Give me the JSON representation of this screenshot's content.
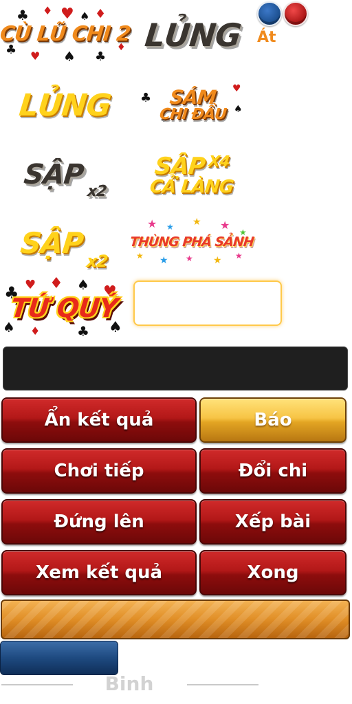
{
  "badges": {
    "cu_lu": "CÙ LŨ CHI 2",
    "lung_dark": "LỦNG",
    "lung_yellow": "LỦNG",
    "sam_line1": "SÁM",
    "sam_line2": "CHI ĐẦU",
    "sap_x2_dark": "SẬP",
    "sap_x2_dark_sub": "x2",
    "sap_x4_line1": "SẬP",
    "sap_x4_mult": "X4",
    "sap_x4_line2": "CẢ LÀNG",
    "sap_x2_yellow": "SẬP",
    "sap_x2_yellow_sub": "x2",
    "thung_pha_sanh": "THÙNG PHÁ SẢNH",
    "tu_quy": "TỨ QUÝ"
  },
  "chips": {
    "label": "Át",
    "colors": [
      "#1a4d8c",
      "#a81414"
    ]
  },
  "input": {
    "value": ""
  },
  "buttons": {
    "an_ket_qua": "Ẩn kết quả",
    "bao": "Báo",
    "choi_tiep": "Chơi tiếp",
    "doi_chi": "Đổi chi",
    "dung_len": "Đứng lên",
    "xep_bai": "Xếp bài",
    "xem_ket_qua": "Xem kết quả",
    "xong": "Xong"
  },
  "footer": {
    "title": "Binh"
  },
  "colors": {
    "button_red": "#b31818",
    "button_gold": "#f7c445",
    "accent_orange": "#f08a1c"
  }
}
